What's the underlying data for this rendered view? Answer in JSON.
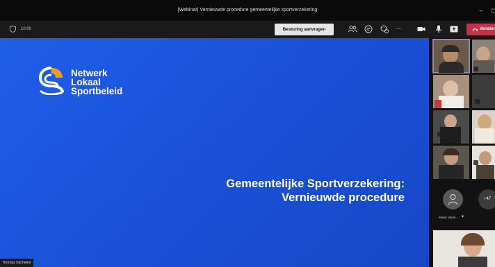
{
  "window": {
    "title": "[Webinar] Vernieuwde procedure gemeentelijke sportverzekering",
    "minimize_glyph": "–",
    "maximize_glyph": "◻"
  },
  "toolbar": {
    "timer": "10:00",
    "request_control_label": "Besturing aanvragen",
    "more_glyph": "···",
    "leave_label": "Verlaten",
    "icons": [
      "people-icon",
      "chat-icon",
      "reactions-icon",
      "more-icon",
      "camera-icon",
      "mic-icon",
      "share-icon",
      "phone-hangup-icon"
    ]
  },
  "slide": {
    "logo_lines": [
      "Netwerk",
      "Lokaal",
      "Sportbeleid"
    ],
    "title_lines": [
      "Gemeentelijke Sportverzekering:",
      "Vernieuwde procedure"
    ],
    "colors": {
      "background": "#1a4fd6",
      "logo_orange": "#f39a1e",
      "text": "#ffffff"
    }
  },
  "presenter_label": "Thomas Stichelen",
  "gallery": {
    "participant_name": "Marie Vaum...",
    "overflow_count": "+47"
  },
  "colors": {
    "leave_button": "#c4314b",
    "titlebar": "#0b0b0b",
    "toolbar": "#1a1a1a"
  }
}
